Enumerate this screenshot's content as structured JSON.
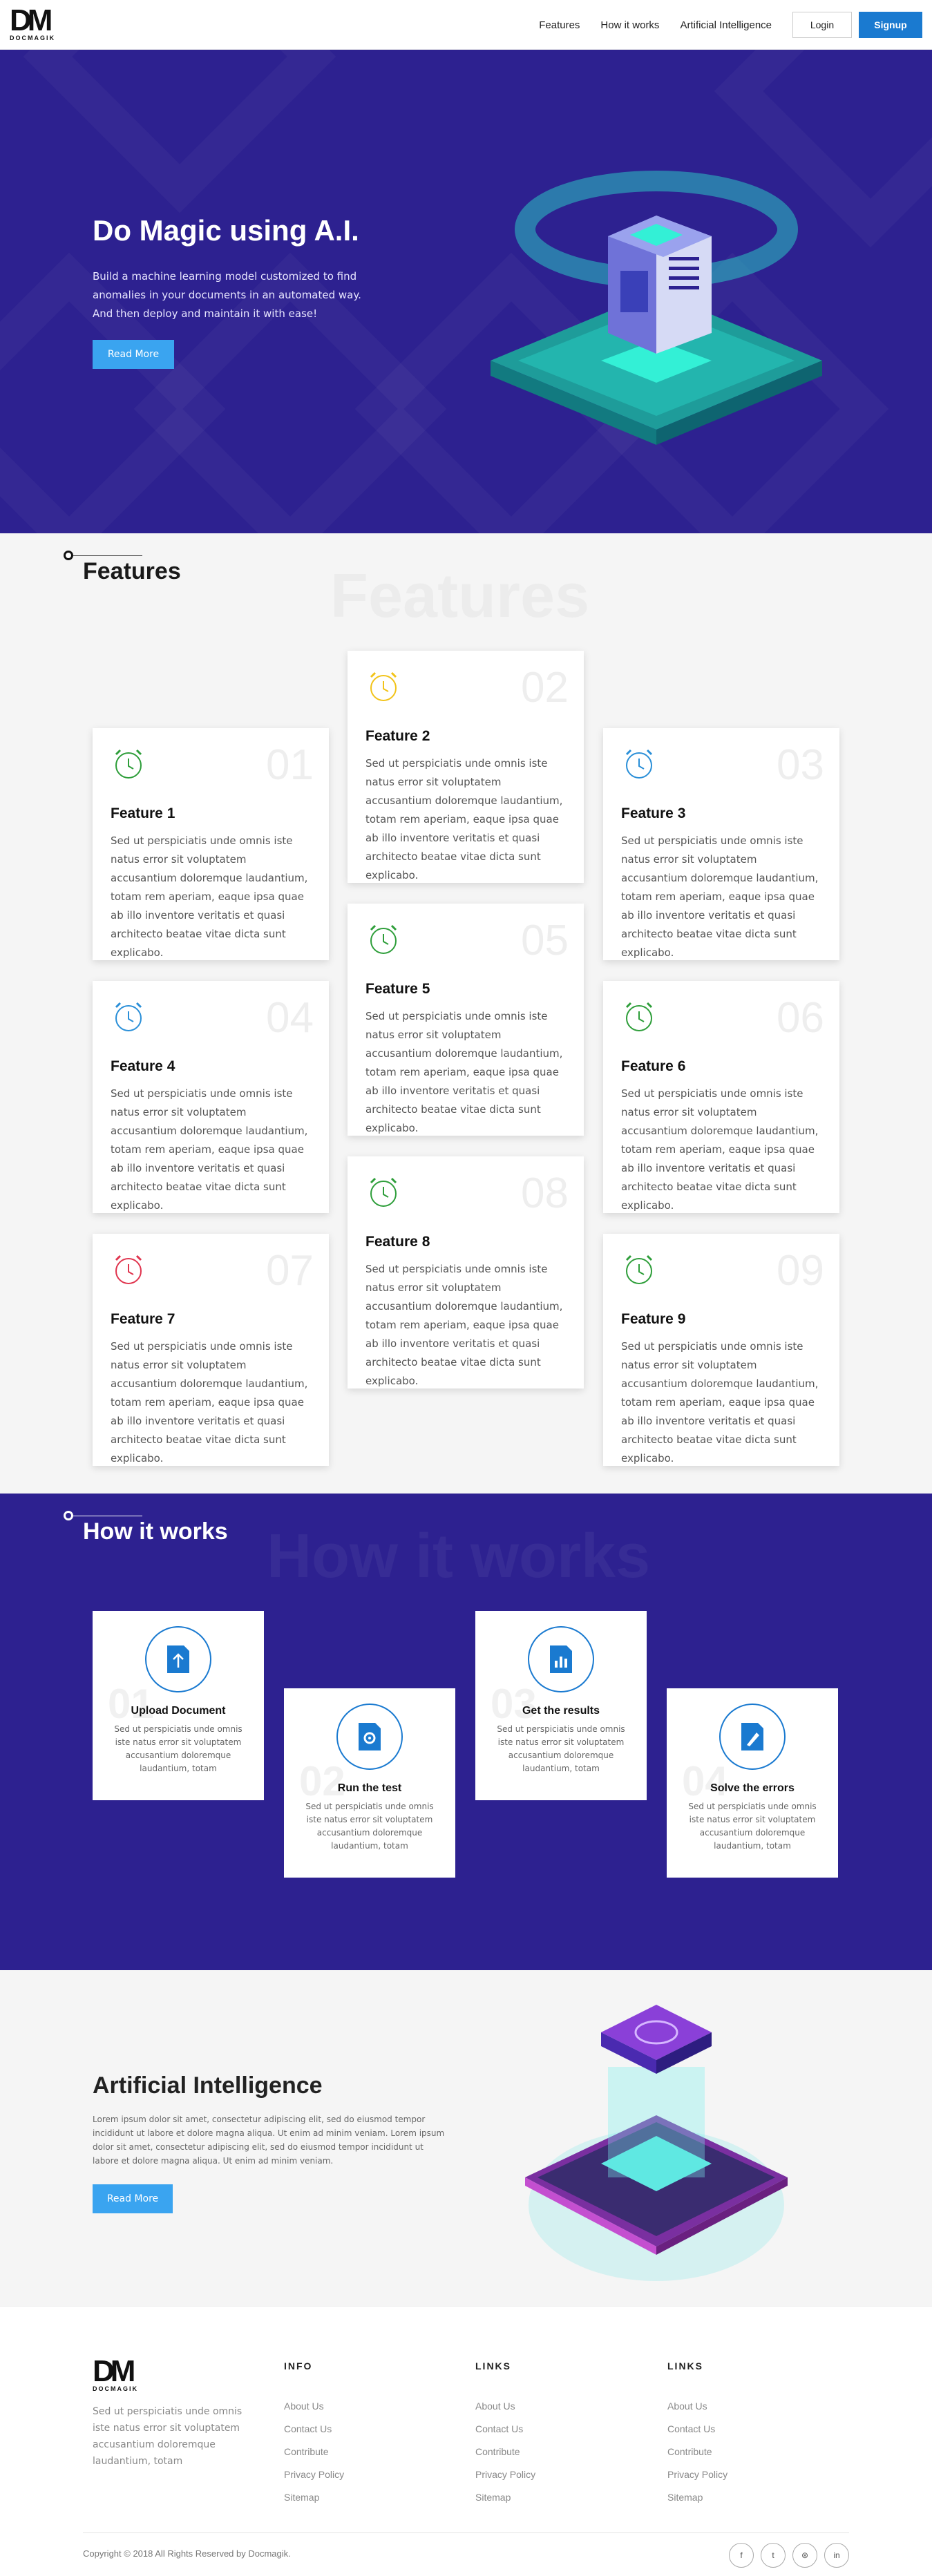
{
  "nav": {
    "logo_mark": "DM",
    "logo_word": "DOCMAGIK",
    "links": [
      "Features",
      "How it works",
      "Artificial Intelligence"
    ],
    "login": "Login",
    "signup": "Signup"
  },
  "hero": {
    "title": "Do Magic using A.I.",
    "text": "Build a machine learning model customized to find anomalies in your documents in an automated way. And then deploy and maintain it with ease!",
    "button": "Read More"
  },
  "features": {
    "title": "Features",
    "ghost": "Features",
    "items": [
      {
        "num": "01",
        "title": "Feature 1",
        "text": "Sed ut perspiciatis unde omnis iste natus error sit voluptatem accusantium doloremque laudantium, totam rem aperiam, eaque ipsa quae ab illo inventore veritatis et quasi architecto beatae vitae dicta sunt explicabo.",
        "color": "#2e9e3a"
      },
      {
        "num": "02",
        "title": "Feature 2",
        "text": "Sed ut perspiciatis unde omnis iste natus error sit voluptatem accusantium doloremque laudantium, totam rem aperiam, eaque ipsa quae ab illo inventore veritatis et quasi architecto beatae vitae dicta sunt explicabo.",
        "color": "#f2c318"
      },
      {
        "num": "03",
        "title": "Feature 3",
        "text": "Sed ut perspiciatis unde omnis iste natus error sit voluptatem accusantium doloremque laudantium, totam rem aperiam, eaque ipsa quae ab illo inventore veritatis et quasi architecto beatae vitae dicta sunt explicabo.",
        "color": "#2a8fd8"
      },
      {
        "num": "04",
        "title": "Feature 4",
        "text": "Sed ut perspiciatis unde omnis iste natus error sit voluptatem accusantium doloremque laudantium, totam rem aperiam, eaque ipsa quae ab illo inventore veritatis et quasi architecto beatae vitae dicta sunt explicabo.",
        "color": "#2a8fd8"
      },
      {
        "num": "05",
        "title": "Feature 5",
        "text": "Sed ut perspiciatis unde omnis iste natus error sit voluptatem accusantium doloremque laudantium, totam rem aperiam, eaque ipsa quae ab illo inventore veritatis et quasi architecto beatae vitae dicta sunt explicabo.",
        "color": "#2e9e3a"
      },
      {
        "num": "06",
        "title": "Feature 6",
        "text": "Sed ut perspiciatis unde omnis iste natus error sit voluptatem accusantium doloremque laudantium, totam rem aperiam, eaque ipsa quae ab illo inventore veritatis et quasi architecto beatae vitae dicta sunt explicabo.",
        "color": "#2e9e3a"
      },
      {
        "num": "07",
        "title": "Feature 7",
        "text": "Sed ut perspiciatis unde omnis iste natus error sit voluptatem accusantium doloremque laudantium, totam rem aperiam, eaque ipsa quae ab illo inventore veritatis et quasi architecto beatae vitae dicta sunt explicabo.",
        "color": "#e0344e"
      },
      {
        "num": "08",
        "title": "Feature 8",
        "text": "Sed ut perspiciatis unde omnis iste natus error sit voluptatem accusantium doloremque laudantium, totam rem aperiam, eaque ipsa quae ab illo inventore veritatis et quasi architecto beatae vitae dicta sunt explicabo.",
        "color": "#2e9e3a"
      },
      {
        "num": "09",
        "title": "Feature 9",
        "text": "Sed ut perspiciatis unde omnis iste natus error sit voluptatem accusantium doloremque laudantium, totam rem aperiam, eaque ipsa quae ab illo inventore veritatis et quasi architecto beatae vitae dicta sunt explicabo.",
        "color": "#2e9e3a"
      }
    ]
  },
  "how": {
    "title": "How it works",
    "ghost": "How it works",
    "steps": [
      {
        "num": "01",
        "title": "Upload Document",
        "text": "Sed ut perspiciatis unde omnis iste natus error sit voluptatem accusantium doloremque laudantium, totam",
        "icon": "upload-icon"
      },
      {
        "num": "02",
        "title": "Run the test",
        "text": "Sed ut perspiciatis unde omnis iste natus error sit voluptatem accusantium doloremque laudantium, totam",
        "icon": "gear-document-icon"
      },
      {
        "num": "03",
        "title": "Get the results",
        "text": "Sed ut perspiciatis unde omnis iste natus error sit voluptatem accusantium doloremque laudantium, totam",
        "icon": "chart-icon"
      },
      {
        "num": "04",
        "title": "Solve the errors",
        "text": "Sed ut perspiciatis unde omnis iste natus error sit voluptatem accusantium doloremque laudantium, totam",
        "icon": "pen-icon"
      }
    ]
  },
  "ai": {
    "title": "Artificial Intelligence",
    "text": "Lorem ipsum dolor sit amet, consectetur adipiscing elit, sed do eiusmod tempor incididunt ut labore et dolore magna aliqua. Ut enim ad minim veniam. Lorem ipsum dolor sit amet, consectetur adipiscing elit, sed do eiusmod tempor incididunt ut labore et dolore magna aliqua. Ut enim ad minim veniam.",
    "button": "Read More"
  },
  "footer": {
    "logo_mark": "DM",
    "logo_word": "DOCMAGIK",
    "desc": "Sed ut perspiciatis unde omnis iste natus error sit voluptatem accusantium doloremque laudantium, totam",
    "cols": [
      {
        "title": "INFO",
        "links": [
          "About Us",
          "Contact Us",
          "Contribute",
          "Privacy Policy",
          "Sitemap"
        ]
      },
      {
        "title": "LINKS",
        "links": [
          "About Us",
          "Contact Us",
          "Contribute",
          "Privacy Policy",
          "Sitemap"
        ]
      },
      {
        "title": "LINKS",
        "links": [
          "About Us",
          "Contact Us",
          "Contribute",
          "Privacy Policy",
          "Sitemap"
        ]
      }
    ],
    "copyright": "Copyright © 2018 All Rights Reserved by Docmagik.",
    "socials": [
      {
        "icon": "facebook-icon",
        "glyph": "f"
      },
      {
        "icon": "twitter-icon",
        "glyph": "t"
      },
      {
        "icon": "dribbble-icon",
        "glyph": "⊛"
      },
      {
        "icon": "linkedin-icon",
        "glyph": "in"
      }
    ]
  },
  "colors": {
    "accent": "#1a7ad0",
    "button_light": "#3aa4f0",
    "hero_bg": "#2d2190",
    "section_bg": "#f5f5f5"
  }
}
